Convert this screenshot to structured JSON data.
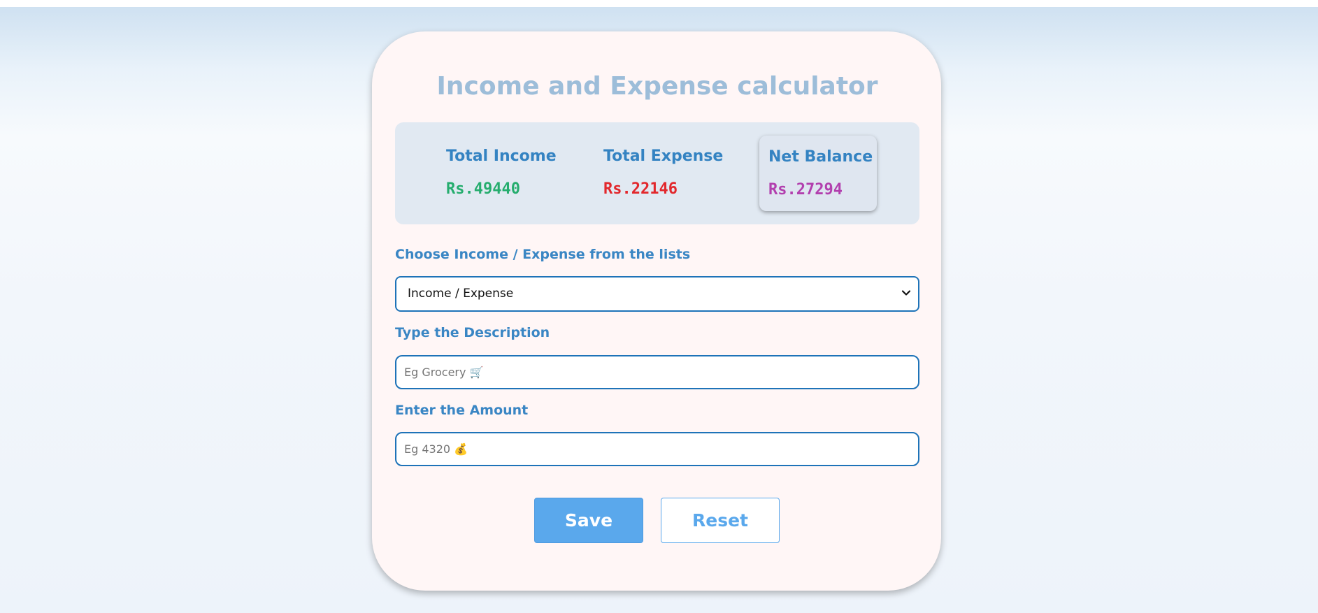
{
  "app": {
    "title": "Income and Expense calculator"
  },
  "summary": {
    "income": {
      "label": "Total Income",
      "value": "Rs.49440",
      "color": "#25ad6e"
    },
    "expense": {
      "label": "Total Expense",
      "value": "Rs.22146",
      "color": "#e2272c"
    },
    "balance": {
      "label": "Net Balance",
      "value": "Rs.27294",
      "color": "#b23fae"
    }
  },
  "form": {
    "type_label": "Choose Income / Expense from the lists",
    "type_select_value": "Income / Expense",
    "description_label": "Type the Description",
    "description_placeholder": "Eg Grocery 🛒",
    "amount_label": "Enter the Amount",
    "amount_placeholder": "Eg 4320 💰"
  },
  "actions": {
    "save_label": "Save",
    "reset_label": "Reset"
  },
  "icons": {
    "select_chevron": "chevron-down-icon"
  },
  "colors": {
    "accent": "#3483c2",
    "title": "#9dbdd9",
    "button": "#5aa8ec",
    "input_border": "#1e73b8",
    "card_bg": "#fff6f6",
    "summary_bg": "#e1e9f2"
  }
}
